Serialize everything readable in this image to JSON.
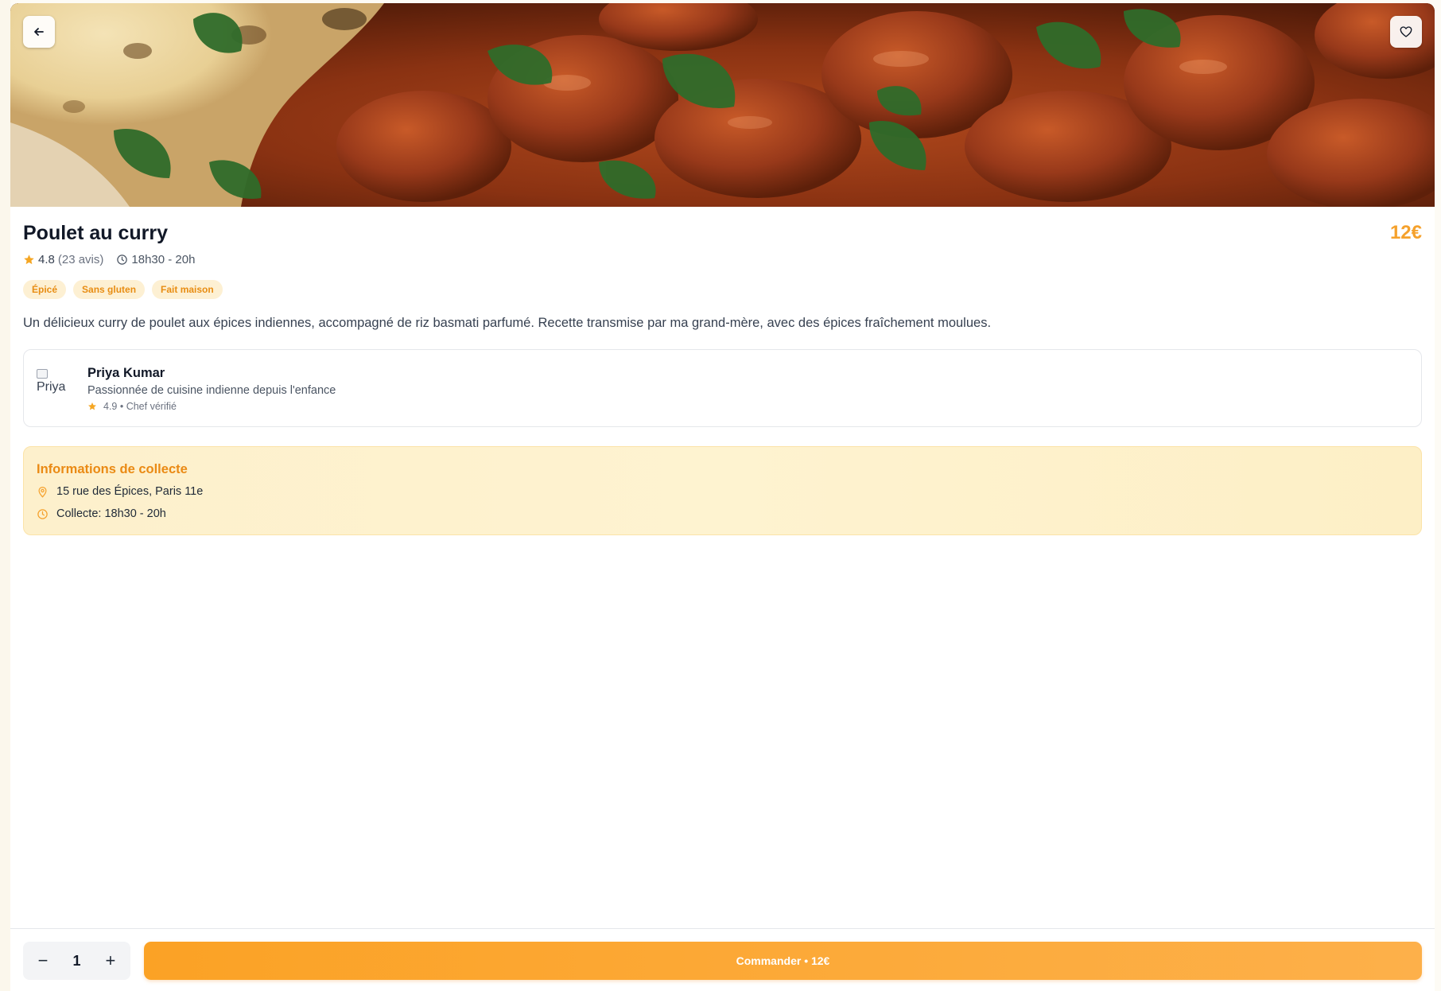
{
  "hero": {
    "image": "chicken-curry-photo",
    "back_icon": "arrow-left-icon",
    "favorite_icon": "heart-icon"
  },
  "dish": {
    "title": "Poulet au curry",
    "price": "12€",
    "rating": "4.8",
    "reviews": "(23 avis)",
    "time": "18h30 - 20h",
    "tags": [
      "Épicé",
      "Sans gluten",
      "Fait maison"
    ],
    "description": "Un délicieux curry de poulet aux épices indiennes, accompagné de riz basmati parfumé. Recette transmise par ma grand-mère, avec des épices fraîchement moulues."
  },
  "chef": {
    "avatar_alt": "Priya",
    "name": "Priya Kumar",
    "bio": "Passionnée de cuisine indienne depuis l'enfance",
    "stats": "4.9 • Chef vérifié"
  },
  "pickup": {
    "title": "Informations de collecte",
    "address": "15 rue des Épices, Paris 11e",
    "collect_time": "Collecte: 18h30 - 20h"
  },
  "order": {
    "quantity": "1",
    "minus_label": "−",
    "plus_label": "+",
    "button_label": "Commander • 12€"
  },
  "colors": {
    "accent": "#f5a12c",
    "tag_bg": "#fdf0d3",
    "tag_text": "#e88d13",
    "pickup_bg": "#fef3d0",
    "star": "#f59e0b"
  }
}
